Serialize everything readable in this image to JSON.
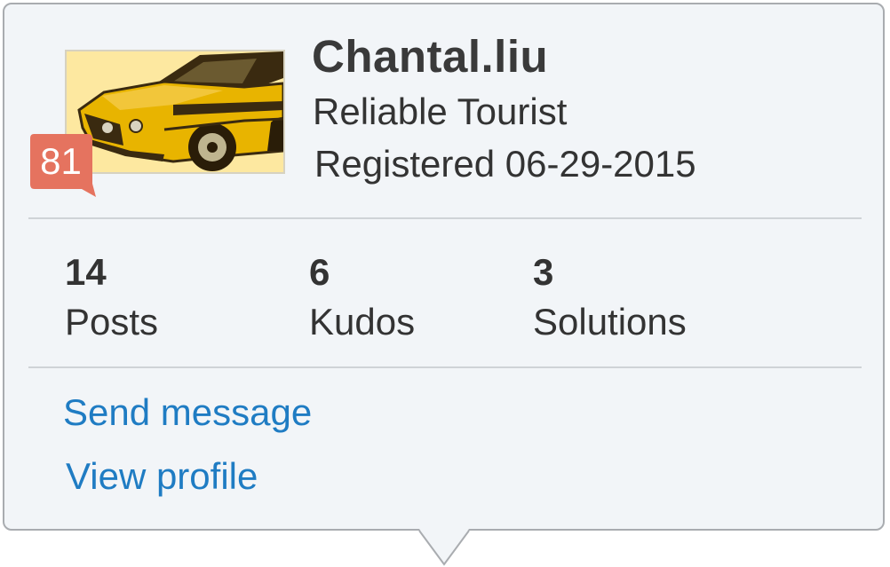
{
  "profile": {
    "username": "Chantal.liu",
    "rank": "Reliable Tourist",
    "registered": "Registered 06-29-2015",
    "avatar_badge": "81",
    "avatar_image": "yellow-muscle-car"
  },
  "stats": [
    {
      "value": "14",
      "label": "Posts"
    },
    {
      "value": "6",
      "label": "Kudos"
    },
    {
      "value": "3",
      "label": "Solutions"
    }
  ],
  "actions": {
    "send_message": "Send message",
    "view_profile": "View profile"
  },
  "colors": {
    "card_background": "#f2f5f8",
    "card_border": "#a9acb0",
    "link": "#1f7cc3",
    "badge": "#e5735f",
    "avatar_background": "#fde8a0",
    "car_body": "#e8b400",
    "car_outline": "#3a2a10"
  }
}
